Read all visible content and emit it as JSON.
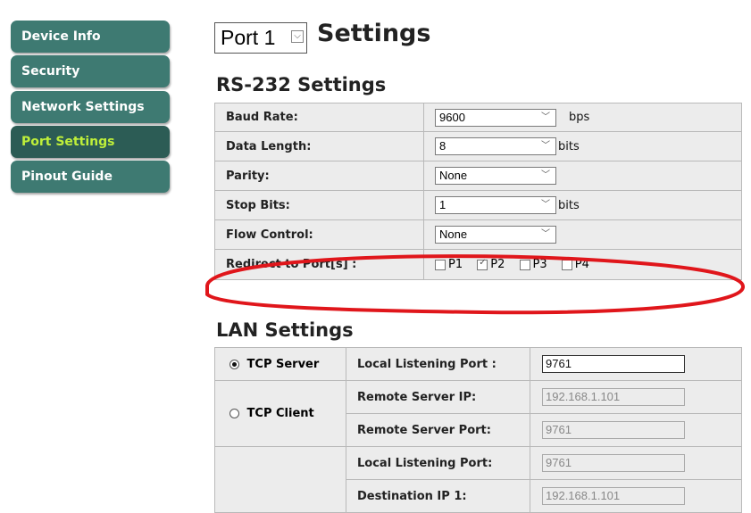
{
  "sidebar": {
    "items": [
      {
        "label": "Device Info"
      },
      {
        "label": "Security"
      },
      {
        "label": "Network Settings"
      },
      {
        "label": "Port Settings",
        "active": true
      },
      {
        "label": "Pinout Guide"
      }
    ]
  },
  "header": {
    "port_select_value": "Port 1",
    "title": "Settings"
  },
  "rs232": {
    "title": "RS-232 Settings",
    "rows": [
      {
        "label": "Baud Rate:",
        "value": "9600",
        "unit": "bps"
      },
      {
        "label": "Data Length:",
        "value": "8",
        "unit": "bits"
      },
      {
        "label": "Parity:",
        "value": "None",
        "unit": ""
      },
      {
        "label": "Stop Bits:",
        "value": "1",
        "unit": "bits"
      },
      {
        "label": "Flow Control:",
        "value": "None",
        "unit": ""
      }
    ],
    "redirect": {
      "label": "Redirect to Port[s] :",
      "ports": [
        {
          "label": "P1",
          "checked": false
        },
        {
          "label": "P2",
          "checked": true
        },
        {
          "label": "P3",
          "checked": false
        },
        {
          "label": "P4",
          "checked": false
        }
      ]
    }
  },
  "lan": {
    "title": "LAN Settings",
    "tcp_server": {
      "label": "TCP Server",
      "selected": true,
      "local_port_label": "Local Listening Port :",
      "local_port_value": "9761"
    },
    "tcp_client": {
      "label": "TCP Client",
      "selected": false,
      "remote_ip_label": "Remote Server IP:",
      "remote_ip_value": "192.168.1.101",
      "remote_port_label": "Remote Server Port:",
      "remote_port_value": "9761"
    },
    "udp": {
      "local_port_label": "Local Listening Port:",
      "local_port_value": "9761",
      "dest_ip_label": "Destination IP 1:",
      "dest_ip_value": "192.168.1.101"
    }
  },
  "colors": {
    "nav_bg": "#3e7a72",
    "nav_active_bg": "#2c5c55",
    "nav_active_text": "#bfef3a",
    "annotation_red": "#e0161b"
  }
}
